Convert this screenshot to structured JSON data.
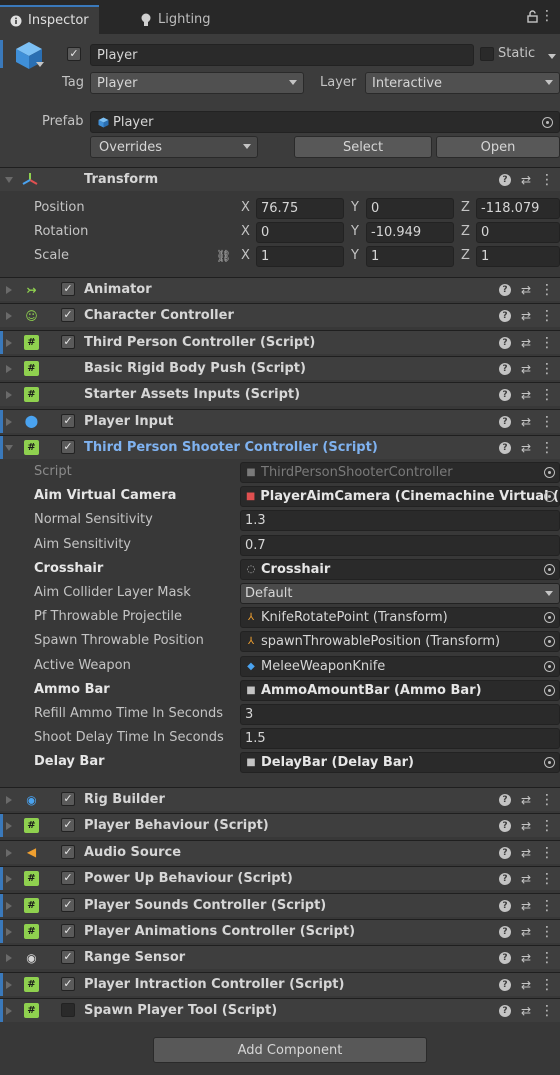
{
  "tabs": [
    {
      "label": "Inspector",
      "icon": "info-icon"
    },
    {
      "label": "Lighting",
      "icon": "bulb-icon"
    }
  ],
  "header": {
    "object_name": "Player",
    "static_label": "Static",
    "tag_label": "Tag",
    "tag_value": "Player",
    "layer_label": "Layer",
    "layer_value": "Interactive",
    "prefab_label": "Prefab",
    "prefab_value": "Player",
    "overrides_label": "Overrides",
    "select_label": "Select",
    "open_label": "Open"
  },
  "transform": {
    "title": "Transform",
    "axis_x": "X",
    "axis_y": "Y",
    "axis_z": "Z",
    "position": {
      "label": "Position",
      "x": "76.75",
      "y": "0",
      "z": "-118.079"
    },
    "rotation": {
      "label": "Rotation",
      "x": "0",
      "y": "-10.949",
      "z": "0"
    },
    "scale": {
      "label": "Scale",
      "x": "1",
      "y": "1",
      "z": "1"
    }
  },
  "components_top": [
    {
      "title": "Animator",
      "icon": "animator-icon",
      "color": "#8fd14f",
      "checkbox": true
    },
    {
      "title": "Character Controller",
      "icon": "character-controller-icon",
      "color": "#8fd14f",
      "checkbox": true
    },
    {
      "title": "Third Person Controller (Script)",
      "icon": "script-icon",
      "color": "#8fd14f",
      "checkbox": true
    },
    {
      "title": "Basic Rigid Body Push (Script)",
      "icon": "script-icon",
      "color": "#8fd14f",
      "checkbox": false
    },
    {
      "title": "Starter Assets Inputs (Script)",
      "icon": "script-icon",
      "color": "#8fd14f",
      "checkbox": false
    },
    {
      "title": "Player Input",
      "icon": "player-input-icon",
      "color": "#4aa3f0",
      "checkbox": true
    }
  ],
  "shooter": {
    "title": "Third Person Shooter Controller (Script)",
    "rows": [
      {
        "label": "Script",
        "value": "ThirdPersonShooterController",
        "style": "dim"
      },
      {
        "label": "Aim Virtual Camera",
        "value": "PlayerAimCamera (Cinemachine Virtual (",
        "style": "bold"
      },
      {
        "label": "Normal Sensitivity",
        "value": "1.3",
        "style": "normal"
      },
      {
        "label": "Aim Sensitivity",
        "value": "0.7",
        "style": "normal"
      },
      {
        "label": "Crosshair",
        "value": "Crosshair",
        "style": "bold"
      },
      {
        "label": "Aim Collider Layer Mask",
        "value": "Default",
        "style": "normal"
      },
      {
        "label": "Pf Throwable Projectile",
        "value": "KnifeRotatePoint (Transform)",
        "style": "normal"
      },
      {
        "label": "Spawn Throwable Position",
        "value": "spawnThrowablePosition (Transform)",
        "style": "normal"
      },
      {
        "label": "Active Weapon",
        "value": "MeleeWeaponKnife",
        "style": "normal"
      },
      {
        "label": "Ammo Bar",
        "value": "AmmoAmountBar (Ammo Bar)",
        "style": "bold"
      },
      {
        "label": "Refill Ammo Time In Seconds",
        "value": "3",
        "style": "normal"
      },
      {
        "label": "Shoot Delay Time In Seconds",
        "value": "1.5",
        "style": "normal"
      },
      {
        "label": "Delay Bar",
        "value": "DelayBar (Delay Bar)",
        "style": "bold"
      }
    ]
  },
  "components_bottom": [
    {
      "title": "Rig Builder",
      "icon": "rig-builder-icon",
      "color": "#4aa3f0",
      "checkbox": true,
      "blue": false
    },
    {
      "title": "Player Behaviour (Script)",
      "icon": "script-icon",
      "color": "#8fd14f",
      "checkbox": true,
      "blue": true
    },
    {
      "title": "Audio Source",
      "icon": "audio-source-icon",
      "color": "#f0a030",
      "checkbox": true,
      "blue": false
    },
    {
      "title": "Power Up Behaviour (Script)",
      "icon": "script-icon",
      "color": "#8fd14f",
      "checkbox": true,
      "blue": true
    },
    {
      "title": "Player Sounds Controller (Script)",
      "icon": "script-icon",
      "color": "#8fd14f",
      "checkbox": true,
      "blue": true
    },
    {
      "title": "Player Animations Controller (Script)",
      "icon": "script-icon",
      "color": "#8fd14f",
      "checkbox": true,
      "blue": true
    },
    {
      "title": "Range Sensor",
      "icon": "range-sensor-icon",
      "color": "#d6d6d6",
      "checkbox": true,
      "blue": false
    },
    {
      "title": "Player Intraction Controller (Script)",
      "icon": "script-icon",
      "color": "#8fd14f",
      "checkbox": true,
      "blue": true
    },
    {
      "title": "Spawn Player Tool (Script)",
      "icon": "script-plus-icon",
      "color": "#8fd14f",
      "checkbox": false,
      "blue": true
    }
  ],
  "add_component_label": "Add Component"
}
